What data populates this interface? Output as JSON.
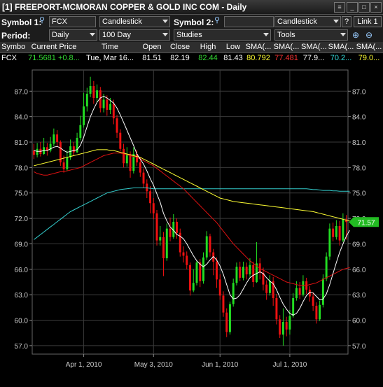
{
  "window": {
    "title": "[1] FREEPORT-MCMORAN COPPER & GOLD INC COM - Daily",
    "buttons": [
      "menu-icon",
      "minimize-icon",
      "maximize-icon",
      "close-icon"
    ]
  },
  "toolbar": {
    "symbol1_label": "Symbol 1:",
    "symbol1_value": "FCX",
    "chart_type1": "Candlestick",
    "symbol2_label": "Symbol 2:",
    "symbol2_value": "",
    "chart_type2": "Candlestick",
    "help_label": "?",
    "link_label": "Link 1",
    "period_label": "Period:",
    "period_value": "Daily",
    "range_value": "100 Day",
    "studies_value": "Studies",
    "tools_value": "Tools"
  },
  "quote_table": {
    "headers": [
      "Symbol",
      "Current Price",
      "Time",
      "Open",
      "Close",
      "High",
      "Low",
      "SMA(...",
      "SMA(...",
      "SMA(...",
      "SMA(...",
      "SMA(..."
    ],
    "values": [
      "FCX",
      "71.5681 +0.8...",
      "Tue, Mar 16...",
      "81.51",
      "82.19",
      "82.44",
      "81.43",
      "80.792",
      "77.481",
      "77.9...",
      "70.2...",
      "79.0..."
    ],
    "value_colors": [
      "#ffffff",
      "#33dd33",
      "#ffffff",
      "#ffffff",
      "#ffffff",
      "#33dd33",
      "#ffffff",
      "#ffff33",
      "#ff3333",
      "#ffffff",
      "#33dddd",
      "#ffff33"
    ]
  },
  "chart_data": {
    "type": "candlestick",
    "yticks": [
      "87.0",
      "84.0",
      "81.0",
      "78.0",
      "75.0",
      "72.0",
      "69.0",
      "66.0",
      "63.0",
      "60.0",
      "57.0"
    ],
    "ylim": [
      56.0,
      89.5
    ],
    "xticks": [
      "Apr 1, 2010",
      "May 3, 2010",
      "Jun 1, 2010",
      "Jul 1, 2010"
    ],
    "xtick_index": [
      15,
      36,
      56,
      77
    ],
    "current_price_label": "71.57",
    "current_price": 71.57,
    "candles": [
      [
        80.0,
        79.5,
        80.8,
        79.0
      ],
      [
        79.5,
        80.2,
        80.9,
        79.2
      ],
      [
        80.2,
        79.6,
        81.0,
        79.3
      ],
      [
        79.6,
        80.4,
        81.5,
        79.5
      ],
      [
        80.4,
        80.0,
        80.9,
        79.4
      ],
      [
        80.0,
        80.8,
        81.6,
        79.8
      ],
      [
        80.8,
        81.9,
        82.6,
        80.5
      ],
      [
        81.9,
        81.0,
        82.4,
        80.4
      ],
      [
        81.0,
        78.6,
        81.2,
        78.2
      ],
      [
        78.6,
        77.8,
        79.4,
        77.4
      ],
      [
        77.8,
        79.2,
        80.0,
        77.6
      ],
      [
        79.2,
        80.5,
        81.3,
        78.9
      ],
      [
        80.5,
        79.8,
        81.0,
        79.4
      ],
      [
        79.8,
        81.5,
        82.1,
        79.7
      ],
      [
        81.5,
        83.0,
        84.1,
        81.2
      ],
      [
        83.0,
        85.2,
        86.8,
        82.7
      ],
      [
        85.2,
        86.7,
        87.4,
        84.6
      ],
      [
        86.7,
        87.6,
        88.7,
        86.3
      ],
      [
        87.6,
        86.2,
        88.2,
        85.5
      ],
      [
        86.2,
        87.1,
        87.8,
        85.7
      ],
      [
        87.1,
        85.0,
        87.5,
        84.5
      ],
      [
        85.0,
        86.0,
        86.7,
        84.5
      ],
      [
        86.0,
        84.8,
        86.5,
        84.1
      ],
      [
        84.8,
        85.5,
        86.2,
        84.3
      ],
      [
        85.5,
        83.8,
        86.0,
        83.1
      ],
      [
        83.8,
        82.1,
        84.2,
        81.5
      ],
      [
        82.1,
        80.2,
        82.5,
        79.9
      ],
      [
        80.2,
        78.5,
        80.8,
        78.0
      ],
      [
        78.5,
        79.6,
        80.4,
        78.1
      ],
      [
        79.6,
        77.6,
        79.9,
        76.8
      ],
      [
        77.6,
        79.6,
        80.4,
        77.3
      ],
      [
        79.6,
        78.6,
        80.1,
        78.2
      ],
      [
        78.6,
        77.4,
        79.2,
        76.9
      ],
      [
        77.4,
        76.1,
        77.9,
        75.6
      ],
      [
        76.1,
        75.2,
        76.6,
        74.4
      ],
      [
        75.2,
        73.8,
        75.8,
        72.6
      ],
      [
        73.8,
        72.6,
        74.4,
        71.9
      ],
      [
        72.6,
        69.4,
        73.0,
        68.8
      ],
      [
        69.4,
        69.8,
        71.1,
        68.8
      ],
      [
        69.8,
        67.3,
        70.4,
        65.2
      ],
      [
        67.3,
        70.8,
        71.4,
        67.0
      ],
      [
        70.8,
        69.8,
        72.1,
        69.3
      ],
      [
        69.8,
        71.6,
        72.5,
        69.6
      ],
      [
        71.6,
        70.3,
        72.0,
        69.6
      ],
      [
        70.3,
        68.0,
        70.8,
        67.5
      ],
      [
        68.0,
        67.6,
        68.7,
        66.8
      ],
      [
        67.6,
        66.5,
        68.1,
        66.0
      ],
      [
        66.5,
        63.5,
        66.8,
        62.9
      ],
      [
        63.5,
        64.4,
        66.0,
        63.3
      ],
      [
        64.4,
        66.8,
        67.1,
        64.1
      ],
      [
        66.8,
        64.6,
        67.2,
        63.9
      ],
      [
        64.6,
        67.4,
        68.0,
        64.3
      ],
      [
        67.4,
        69.9,
        70.5,
        67.1
      ],
      [
        69.9,
        68.0,
        70.2,
        67.5
      ],
      [
        68.0,
        66.9,
        68.4,
        65.3
      ],
      [
        66.9,
        64.8,
        67.4,
        63.8
      ],
      [
        64.8,
        62.9,
        65.4,
        62.4
      ],
      [
        62.9,
        60.9,
        63.4,
        60.4
      ],
      [
        60.9,
        58.6,
        61.4,
        58.0
      ],
      [
        58.6,
        61.9,
        62.2,
        58.3
      ],
      [
        61.9,
        64.4,
        64.9,
        61.6
      ],
      [
        64.4,
        66.3,
        66.8,
        64.1
      ],
      [
        66.3,
        65.0,
        66.9,
        64.6
      ],
      [
        65.0,
        66.3,
        66.9,
        64.7
      ],
      [
        66.3,
        65.4,
        66.8,
        64.8
      ],
      [
        65.4,
        66.5,
        67.3,
        65.1
      ],
      [
        66.5,
        64.5,
        66.9,
        63.9
      ],
      [
        64.5,
        66.7,
        69.2,
        64.4
      ],
      [
        66.7,
        65.6,
        67.3,
        64.8
      ],
      [
        65.6,
        64.2,
        66.2,
        63.5
      ],
      [
        64.2,
        63.2,
        64.7,
        62.4
      ],
      [
        63.2,
        64.6,
        65.3,
        62.9
      ],
      [
        64.6,
        62.6,
        65.1,
        61.7
      ],
      [
        62.6,
        60.1,
        63.1,
        59.5
      ],
      [
        60.1,
        58.3,
        60.6,
        57.9
      ],
      [
        58.3,
        59.8,
        61.4,
        57.0
      ],
      [
        59.8,
        58.9,
        60.4,
        58.1
      ],
      [
        58.9,
        60.5,
        61.2,
        58.3
      ],
      [
        60.5,
        62.6,
        63.2,
        60.3
      ],
      [
        62.6,
        63.8,
        64.6,
        62.3
      ],
      [
        63.8,
        63.0,
        64.5,
        62.5
      ],
      [
        63.0,
        64.6,
        65.3,
        62.8
      ],
      [
        64.6,
        63.6,
        65.0,
        63.1
      ],
      [
        63.6,
        62.8,
        64.0,
        62.2
      ],
      [
        62.8,
        61.7,
        63.3,
        61.1
      ],
      [
        61.7,
        60.1,
        62.1,
        59.6
      ],
      [
        60.1,
        61.8,
        62.3,
        59.9
      ],
      [
        61.8,
        64.9,
        65.4,
        61.5
      ],
      [
        64.9,
        67.5,
        68.0,
        64.6
      ],
      [
        67.5,
        70.8,
        71.4,
        67.1
      ],
      [
        70.8,
        69.8,
        71.5,
        69.3
      ],
      [
        69.8,
        71.1,
        71.8,
        69.5
      ],
      [
        71.1,
        69.4,
        71.7,
        68.8
      ],
      [
        69.4,
        71.9,
        72.6,
        69.2
      ],
      [
        71.9,
        71.57,
        72.4,
        69.5
      ]
    ],
    "sma_fast": [
      80.0,
      79.9,
      79.9,
      80.0,
      80.0,
      80.2,
      80.4,
      80.5,
      80.3,
      80.0,
      79.8,
      79.9,
      80.0,
      80.1,
      80.6,
      81.6,
      82.8,
      84.0,
      84.9,
      85.7,
      86.2,
      86.4,
      86.2,
      85.9,
      85.6,
      85.0,
      84.2,
      83.3,
      82.4,
      81.5,
      80.6,
      79.6,
      79.0,
      78.4,
      77.6,
      76.7,
      75.9,
      74.9,
      73.9,
      72.6,
      71.7,
      71.0,
      70.6,
      70.1,
      69.9,
      69.6,
      69.0,
      68.3,
      67.6,
      67.0,
      66.6,
      66.3,
      66.6,
      67.1,
      67.5,
      67.1,
      66.4,
      65.4,
      64.2,
      63.0,
      62.5,
      62.6,
      63.0,
      63.7,
      64.4,
      65.0,
      65.3,
      65.5,
      65.7,
      65.5,
      65.0,
      64.6,
      64.3,
      63.6,
      62.7,
      61.9,
      61.3,
      60.8,
      60.6,
      60.8,
      61.4,
      62.2,
      62.9,
      63.3,
      63.2,
      62.8,
      62.4,
      62.5,
      63.1,
      64.2,
      65.5,
      66.8,
      68.0,
      69.0,
      69.9,
      70.6
    ],
    "sma_mid": [
      78.2,
      78.3,
      78.4,
      78.5,
      78.6,
      78.7,
      78.8,
      78.9,
      79.0,
      79.1,
      79.2,
      79.3,
      79.4,
      79.5,
      79.6,
      79.7,
      79.8,
      79.9,
      80.0,
      80.1,
      80.1,
      80.1,
      80.1,
      80.0,
      80.0,
      79.9,
      79.8,
      79.7,
      79.6,
      79.5,
      79.4,
      79.3,
      79.2,
      79.0,
      78.8,
      78.6,
      78.4,
      78.2,
      78.0,
      77.8,
      77.6,
      77.4,
      77.2,
      77.0,
      76.8,
      76.6,
      76.4,
      76.2,
      76.0,
      75.8,
      75.6,
      75.4,
      75.2,
      75.0,
      74.8,
      74.6,
      74.4,
      74.3,
      74.2,
      74.1,
      74.0,
      73.95,
      73.9,
      73.85,
      73.8,
      73.75,
      73.7,
      73.65,
      73.6,
      73.55,
      73.5,
      73.45,
      73.4,
      73.35,
      73.3,
      73.25,
      73.2,
      73.15,
      73.1,
      73.05,
      73.0,
      72.95,
      72.9,
      72.85,
      72.8,
      72.7,
      72.6,
      72.5,
      72.4,
      72.3,
      72.2,
      72.1,
      72.0,
      71.9,
      71.8,
      71.7
    ],
    "sma_slow": [
      77.5,
      77.3,
      77.2,
      77.1,
      77.1,
      77.2,
      77.3,
      77.4,
      77.5,
      77.5,
      77.6,
      77.7,
      77.8,
      77.9,
      78.0,
      78.2,
      78.4,
      78.6,
      78.8,
      79.0,
      79.2,
      79.4,
      79.5,
      79.6,
      79.7,
      79.7,
      79.7,
      79.6,
      79.5,
      79.4,
      79.3,
      79.2,
      79.0,
      78.8,
      78.6,
      78.4,
      78.2,
      77.9,
      77.6,
      77.3,
      77.0,
      76.7,
      76.4,
      76.1,
      75.8,
      75.5,
      75.1,
      74.7,
      74.3,
      73.9,
      73.5,
      73.1,
      72.7,
      72.3,
      71.9,
      71.5,
      71.0,
      70.5,
      70.0,
      69.5,
      69.0,
      68.6,
      68.2,
      67.8,
      67.4,
      67.0,
      66.7,
      66.4,
      66.1,
      65.9,
      65.7,
      65.5,
      65.3,
      65.1,
      64.9,
      64.7,
      64.5,
      64.4,
      64.3,
      64.2,
      64.1,
      64.1,
      64.1,
      64.2,
      64.3,
      64.4,
      64.6,
      64.8,
      65.0,
      65.2,
      65.4,
      65.6,
      65.8,
      66.0,
      66.1,
      66.2
    ],
    "sma_long": [
      69.5,
      69.8,
      70.1,
      70.4,
      70.7,
      71.0,
      71.3,
      71.6,
      71.9,
      72.2,
      72.5,
      72.8,
      73.0,
      73.2,
      73.4,
      73.6,
      73.8,
      74.0,
      74.2,
      74.4,
      74.6,
      74.8,
      75.0,
      75.1,
      75.2,
      75.3,
      75.4,
      75.45,
      75.5,
      75.55,
      75.6,
      75.6,
      75.6,
      75.6,
      75.6,
      75.55,
      75.5,
      75.5,
      75.5,
      75.5,
      75.5,
      75.5,
      75.5,
      75.5,
      75.5,
      75.5,
      75.5,
      75.5,
      75.5,
      75.5,
      75.5,
      75.5,
      75.5,
      75.5,
      75.5,
      75.5,
      75.5,
      75.5,
      75.5,
      75.5,
      75.5,
      75.5,
      75.5,
      75.5,
      75.5,
      75.5,
      75.5,
      75.5,
      75.5,
      75.5,
      75.5,
      75.5,
      75.5,
      75.5,
      75.5,
      75.5,
      75.5,
      75.5,
      75.5,
      75.5,
      75.5,
      75.5,
      75.5,
      75.45,
      75.4,
      75.4,
      75.35,
      75.3,
      75.3,
      75.3,
      75.25,
      75.25,
      75.2,
      75.2,
      75.2,
      75.2
    ],
    "series_colors": {
      "sma_fast": "#ffffff",
      "sma_mid": "#ffff33",
      "sma_slow": "#dd1111",
      "sma_long": "#33cccc"
    },
    "up_color": "#22dd22",
    "down_color": "#ee1111",
    "grid": true
  }
}
